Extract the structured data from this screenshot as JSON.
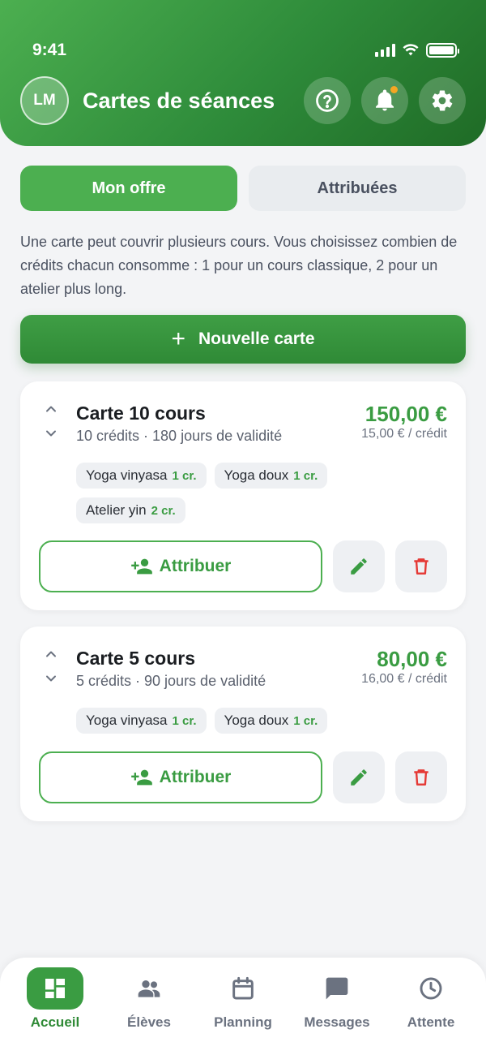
{
  "status_bar": {
    "time": "9:41"
  },
  "header": {
    "avatar_initials": "LM",
    "title": "Cartes de séances",
    "buttons": [
      "help-icon",
      "bell-icon",
      "gear-icon"
    ]
  },
  "tabs": {
    "active": "Mon offre",
    "inactive": "Attribuées"
  },
  "info_text": "Une carte peut couvrir plusieurs cours. Vous choisissez combien de crédits chacun consomme : 1 pour un cours classique, 2 pour un atelier plus long.",
  "new_card_button": {
    "label": "Nouvelle carte"
  },
  "cards": [
    {
      "name": "Carte 10 cours",
      "meta": "10 crédits · 180 jours de validité",
      "price": "150,00 €",
      "unit_price": "15,00 € / crédit",
      "courses": [
        {
          "name": "Yoga vinyasa",
          "credits": "1 cr."
        },
        {
          "name": "Yoga doux",
          "credits": "1 cr."
        },
        {
          "name": "Atelier yin",
          "credits": "2 cr."
        }
      ],
      "assign_label": "Attribuer"
    },
    {
      "name": "Carte 5 cours",
      "meta": "5 crédits · 90 jours de validité",
      "price": "80,00 €",
      "unit_price": "16,00 € / crédit",
      "courses": [
        {
          "name": "Yoga vinyasa",
          "credits": "1 cr."
        },
        {
          "name": "Yoga doux",
          "credits": "1 cr."
        }
      ],
      "assign_label": "Attribuer"
    }
  ],
  "bottom_nav": [
    {
      "label": "Accueil",
      "icon": "dashboard-icon",
      "active": true
    },
    {
      "label": "Élèves",
      "icon": "people-icon",
      "active": false
    },
    {
      "label": "Planning",
      "icon": "calendar-icon",
      "active": false
    },
    {
      "label": "Messages",
      "icon": "chat-icon",
      "active": false
    },
    {
      "label": "Attente",
      "icon": "clock-icon",
      "active": false
    }
  ],
  "colors": {
    "primary": "#4caf50",
    "primary_dark": "#2e7d32",
    "price": "#3a9c42",
    "danger": "#e53935",
    "notification": "#f5a623"
  }
}
